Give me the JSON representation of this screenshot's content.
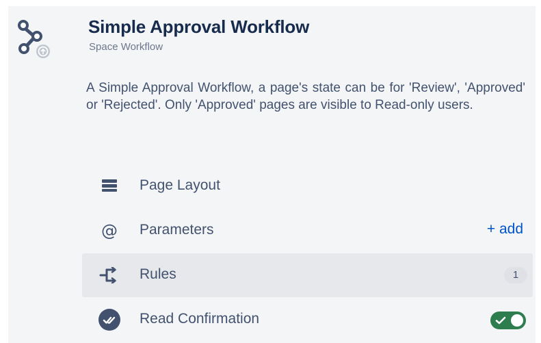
{
  "header": {
    "title": "Simple Approval Workflow",
    "subtitle": "Space Workflow",
    "icon": "workflow-nodes-icon"
  },
  "description": "A Simple Approval Workflow, a page's state can be for 'Review', 'Approved' or 'Rejected'. Only 'Approved' pages are visible to Read-only users.",
  "menu": {
    "items": [
      {
        "label": "Page Layout",
        "icon": "page-layout-icon"
      },
      {
        "label": "Parameters",
        "icon": "at-icon",
        "action_label": "+ add"
      },
      {
        "label": "Rules",
        "icon": "rules-icon",
        "count": "1",
        "active": true
      },
      {
        "label": "Read Confirmation",
        "icon": "double-check-icon",
        "toggle_on": true
      }
    ]
  },
  "colors": {
    "accent_link": "#0052cc",
    "toggle_on": "#2e7d4f",
    "text_primary": "#172b4d",
    "text_secondary": "#42526e",
    "panel_bg": "#f4f5f7"
  }
}
